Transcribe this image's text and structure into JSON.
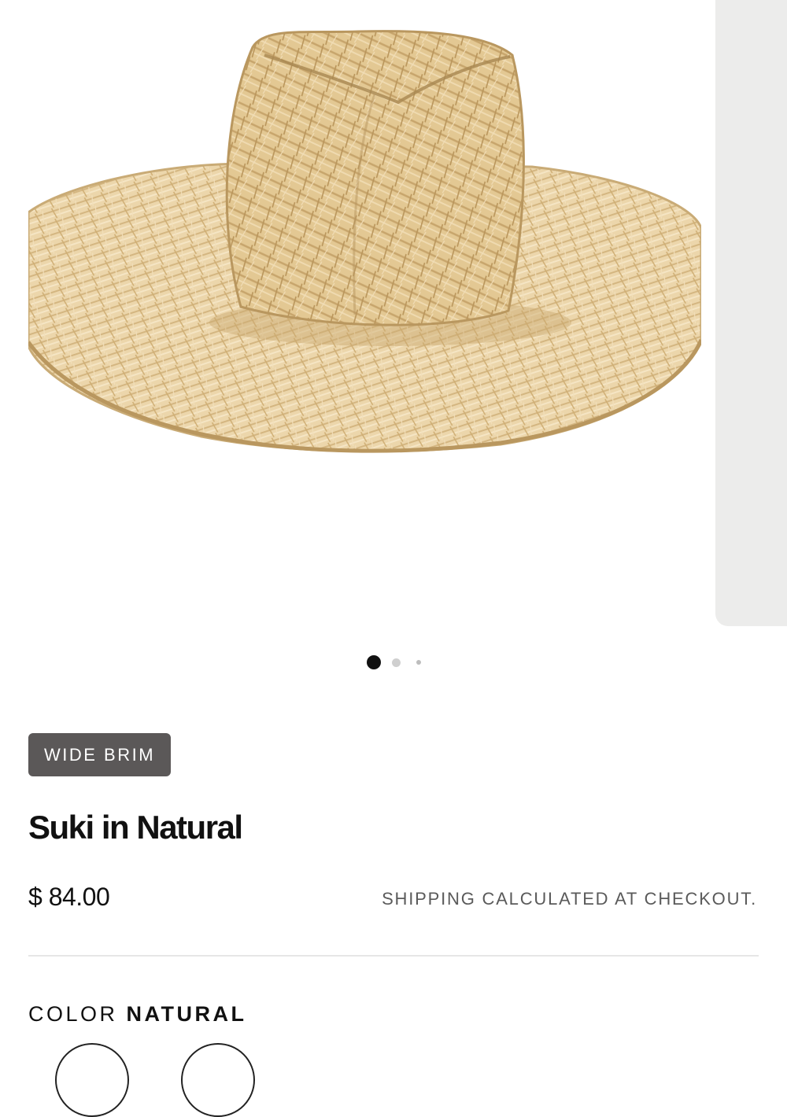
{
  "product": {
    "image_icon": "straw-wide-brim-hat",
    "badge": "WIDE BRIM",
    "title": "Suki in Natural",
    "price": "$ 84.00",
    "shipping_note": "SHIPPING CALCULATED AT CHECKOUT.",
    "color_label": "COLOR",
    "color_value": "NATURAL"
  },
  "gallery": {
    "slide_count": 3,
    "active_slide": 1
  },
  "colors": {
    "badge_bg": "#5b5858",
    "straw": "#e9d2a6",
    "straw_dark": "#c9ab76"
  }
}
